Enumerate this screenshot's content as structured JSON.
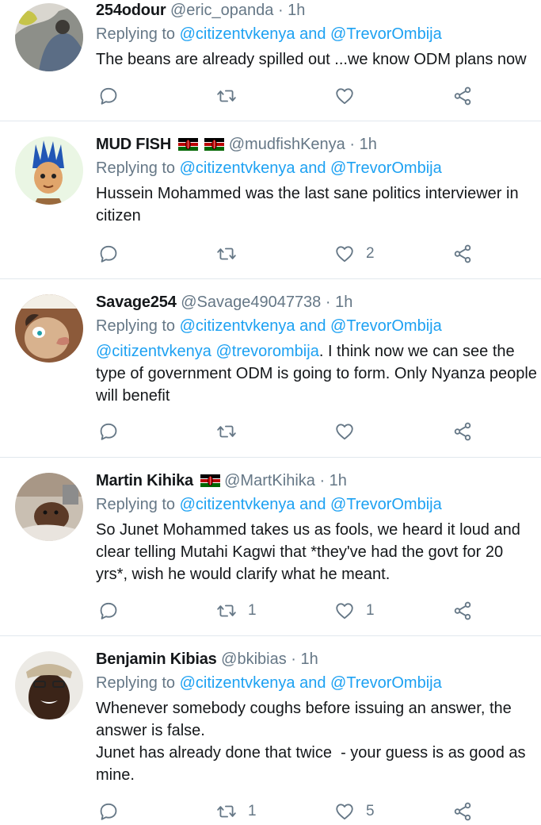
{
  "replying_prefix": "Replying to",
  "replying_to": "@citizentvkenya and @TrevorOmbija",
  "icons": {
    "reply": "reply-icon",
    "retweet": "retweet-icon",
    "like": "heart-icon",
    "share": "share-icon",
    "flag": "kenya-flag-icon"
  },
  "colors": {
    "link": "#1da1f2",
    "meta": "#657786",
    "divider": "#e1e8ed",
    "kenya_flag": [
      "#000000",
      "#bb0000",
      "#006600",
      "#ffffff"
    ]
  },
  "tweets": [
    {
      "name": "254odour",
      "handle": "@eric_opanda",
      "time": "· 1h",
      "body": "The beans are already spilled out ...we know ODM plans now",
      "link_prefix": "",
      "replies": "",
      "retweets": "",
      "likes": ""
    },
    {
      "name": "MUD FISH",
      "handle": "@mudfishKenya",
      "time": "· 1h",
      "body": "Hussein Mohammed was the last sane politics interviewer in\ncitizen",
      "link_prefix": "",
      "replies": "",
      "retweets": "",
      "likes": "2"
    },
    {
      "name": "Savage254",
      "handle": "@Savage49047738",
      "time": "· 1h",
      "link_prefix": "@citizentvkenya @trevorombija",
      "body": ". I think now we can see the\ntype of government ODM is going to form. Only Nyanza people\nwill benefit",
      "replies": "",
      "retweets": "",
      "likes": ""
    },
    {
      "name": "Martin Kihika",
      "handle": "@MartKihika",
      "time": "· 1h",
      "body": "So Junet Mohammed takes us as fools, we heard it loud and\nclear telling Mutahi Kagwi that *they've had the govt for 20\nyrs*, wish he would clarify what he meant.",
      "link_prefix": "",
      "replies": "",
      "retweets": "1",
      "likes": "1"
    },
    {
      "name": "Benjamin Kibias",
      "handle": "@bkibias",
      "time": "· 1h",
      "body": "Whenever somebody coughs before issuing an answer, the\nanswer is false.\nJunet has already done that twice  - your guess is as good as\nmine.",
      "link_prefix": "",
      "replies": "",
      "retweets": "1",
      "likes": "5"
    }
  ]
}
